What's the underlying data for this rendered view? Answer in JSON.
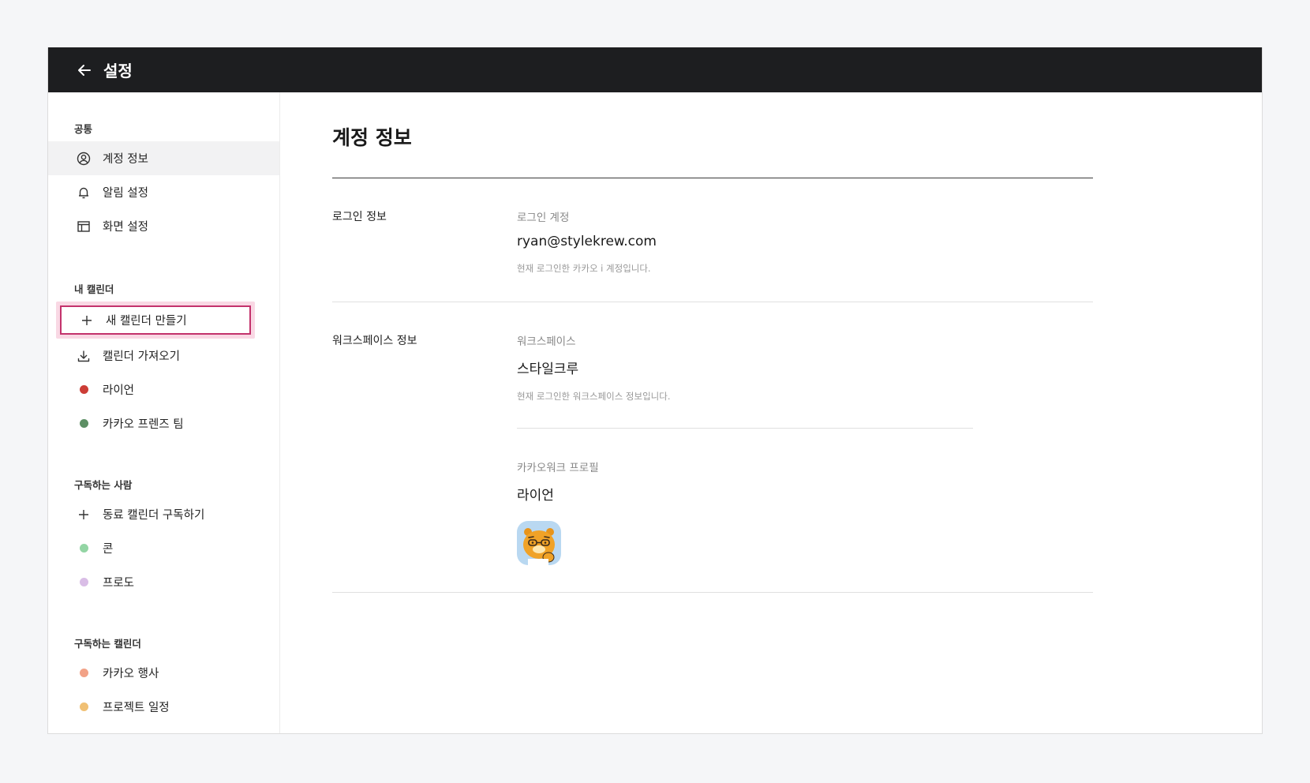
{
  "window": {
    "title": "설정"
  },
  "sidebar": {
    "sections": [
      {
        "title": "공통",
        "items": [
          {
            "label": "계정 정보",
            "icon": "user-circle-icon",
            "active": true
          },
          {
            "label": "알림 설정",
            "icon": "bell-icon"
          },
          {
            "label": "화면 설정",
            "icon": "layout-icon"
          }
        ]
      },
      {
        "title": "내 캘린더",
        "items": [
          {
            "label": "새 캘린더 만들기",
            "icon": "plus-icon",
            "highlighted": true
          },
          {
            "label": "캘린더 가져오기",
            "icon": "download-icon"
          },
          {
            "label": "라이언",
            "color": "#cc3d36"
          },
          {
            "label": "카카오 프렌즈 팀",
            "color": "#5d8f64"
          }
        ]
      },
      {
        "title": "구독하는 사람",
        "items": [
          {
            "label": "동료 캘린더 구독하기",
            "icon": "plus-icon"
          },
          {
            "label": "콘",
            "color": "#93d5a4"
          },
          {
            "label": "프로도",
            "color": "#d9bde6"
          }
        ]
      },
      {
        "title": "구독하는 캘린더",
        "items": [
          {
            "label": "카카오 행사",
            "color": "#f2a287"
          },
          {
            "label": "프로젝트 일정",
            "color": "#f0c074"
          }
        ]
      }
    ]
  },
  "main": {
    "title": "계정 정보",
    "login": {
      "section_label": "로그인 정보",
      "field_label": "로그인 계정",
      "value": "ryan@stylekrew.com",
      "help": "현재 로그인한 카카오 i 계정입니다."
    },
    "workspace": {
      "section_label": "워크스페이스 정보",
      "field_label": "워크스페이스",
      "value": "스타일크루",
      "help": "현재 로그인한 워크스페이스 정보입니다.",
      "profile_label": "카카오워크 프로필",
      "profile_name": "라이언"
    }
  }
}
